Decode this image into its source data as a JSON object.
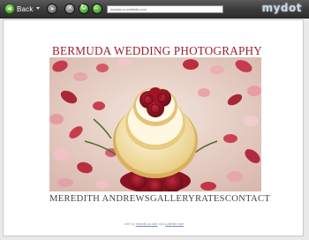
{
  "browser": {
    "back_label": "Back",
    "address": "meada.co.website.com",
    "brand": "mydot"
  },
  "site": {
    "title": "BERMUDA WEDDING PHOTOGRAPHY",
    "nav": [
      "MEREDITH ANDREWS",
      "GALLERY",
      "RATES",
      "CONTACT"
    ],
    "credit": {
      "prefix": "site by",
      "link1": "meadb.co.site",
      "joiner": "and",
      "link2": "partnill.rose"
    }
  },
  "colors": {
    "title": "#9b1f2c",
    "toolbar": "#3a3a3a",
    "nav": "#444444"
  }
}
